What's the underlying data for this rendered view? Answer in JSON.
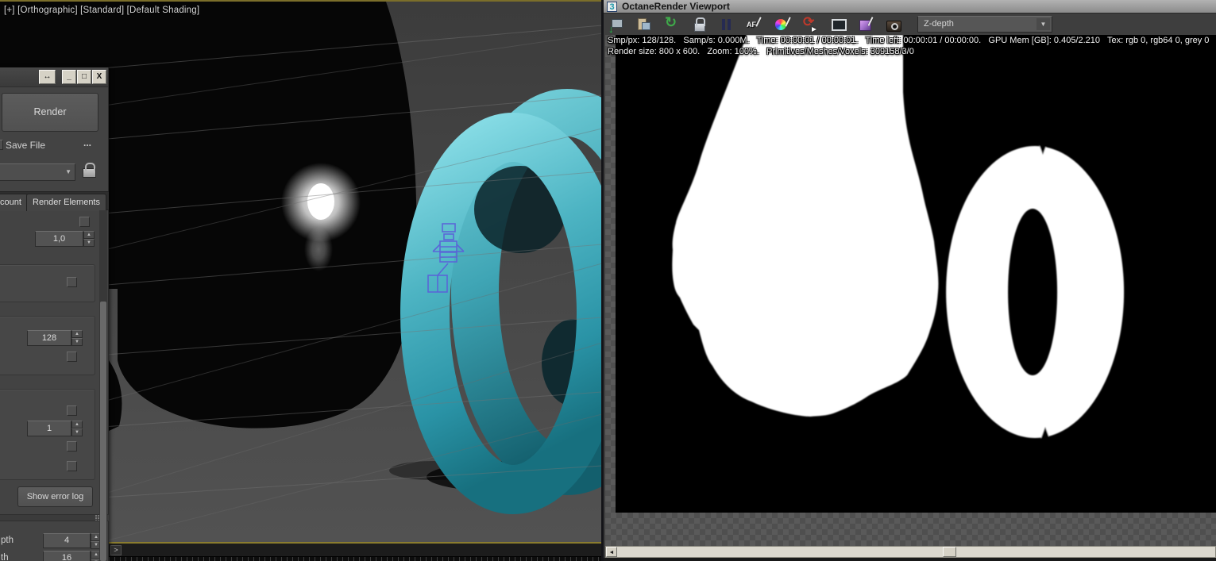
{
  "viewport": {
    "label": "[+] [Orthographic] [Standard] [Default Shading]",
    "maxscript_prompt": ">"
  },
  "render_setup": {
    "window_buttons": {
      "resize": "↔",
      "minimize": "_",
      "maximize": "□",
      "close": "X"
    },
    "render_button": "Render",
    "save_file_label": "Save File",
    "browse_button": "...",
    "tabs": [
      {
        "label": "count"
      },
      {
        "label": "Render Elements"
      }
    ],
    "spinners": {
      "value_top": "1,0",
      "value_mid": "128",
      "value_low": "1",
      "depth_row1": {
        "label": "pth",
        "value": "4"
      },
      "depth_row2": {
        "label": "th",
        "value": "16"
      }
    },
    "show_error_log_button": "Show error log"
  },
  "octane": {
    "window_title": "OctaneRender Viewport",
    "app_icon_text": "3",
    "toolbar_icons": [
      "save-render-icon",
      "copy-clipboard-icon",
      "restart-render-icon",
      "lock-icon",
      "pause-icon",
      "autofocus-picker-icon",
      "white-balance-picker-icon",
      "reload-scene-icon",
      "viewport-sync-icon",
      "render-passes-picker-icon",
      "camera-icon"
    ],
    "render_pass_dropdown": "Z-depth",
    "dropdown_arrow": "▼",
    "scroll_left_arrow": "◄",
    "status_line1": "Smp/px: 128/128.   Samp/s: 0.000M.   Time: 00:00:01 / 00:00:01.   Time left: 00:00:01 / 00:00:00.   GPU Mem [GB]: 0.405/2.210   Tex: rgb 0, rgb64 0, grey 0",
    "status_line2": "Render size: 800 x 600.   Zoom: 100%.   Primitives/Meshes/Voxels: 309158/3/0",
    "render_stats": {
      "samples_per_pixel": "128/128",
      "samples_per_second": "0.000M",
      "time": "00:00:01 / 00:00:01",
      "time_left": "00:00:01 / 00:00:00",
      "gpu_mem_gb": "0.405/2.210",
      "tex": "rgb 0, rgb64 0, grey 0",
      "render_size": "800 x 600",
      "zoom": "100%",
      "primitives_meshes_voxels": "309158/3/0"
    }
  },
  "colors": {
    "torus_teal": "#4fb6c4",
    "viewport_bg": "#454545",
    "panel_bg": "#434343",
    "octane_toolbar_bg": "#3e3e3e",
    "titlebar_gray": "#9c9c9c",
    "active_viewport_gold": "#8a7c2e"
  }
}
